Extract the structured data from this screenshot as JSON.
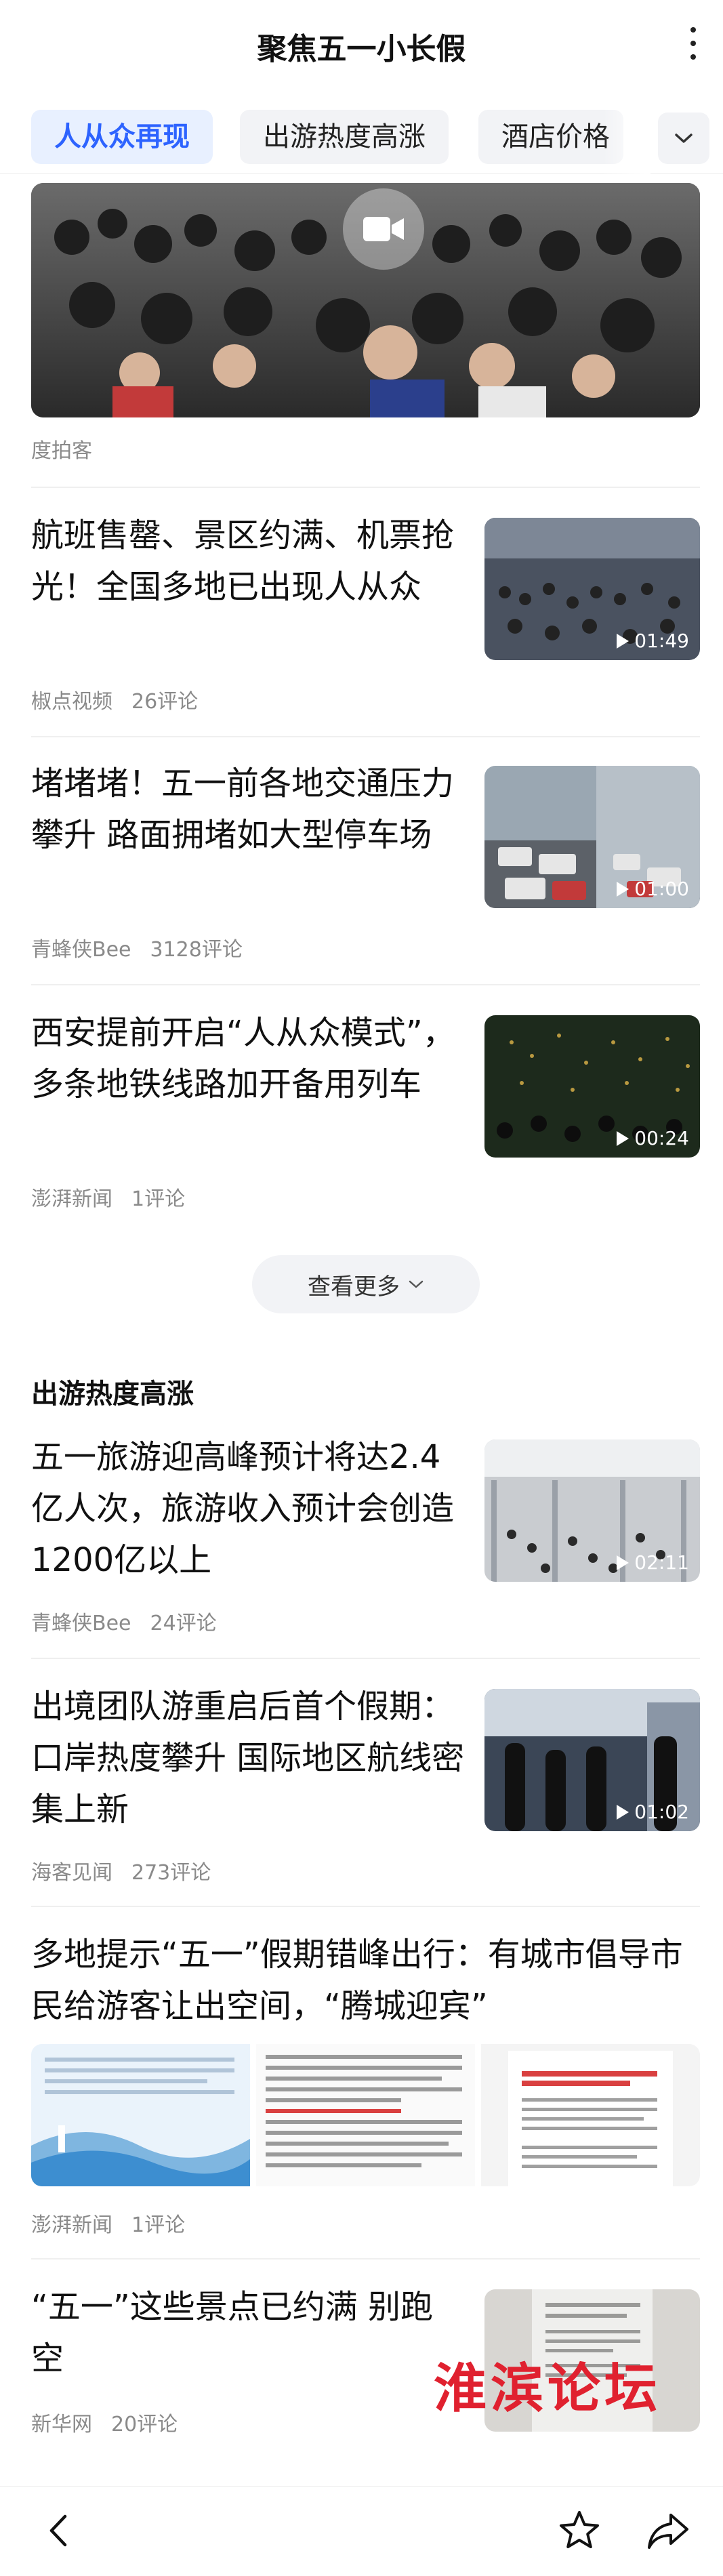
{
  "header": {
    "title": "聚焦五一小长假"
  },
  "tabs": [
    {
      "label": "人从众再现"
    },
    {
      "label": "出游热度高涨"
    },
    {
      "label": "酒店价格"
    }
  ],
  "hero": {
    "source": "度拍客"
  },
  "articles": [
    {
      "title": "航班售罄、景区约满、机票抢光！全国多地已出现人从众",
      "source": "椒点视频",
      "comments": "26评论",
      "duration": "01:49"
    },
    {
      "title": "堵堵堵！五一前各地交通压力攀升 路面拥堵如大型停车场",
      "source": "青蜂侠Bee",
      "comments": "3128评论",
      "duration": "01:00"
    },
    {
      "title": "西安提前开启“人从众模式”，多条地铁线路加开备用列车",
      "source": "澎湃新闻",
      "comments": "1评论",
      "duration": "00:24"
    }
  ],
  "see_more": {
    "label": "查看更多"
  },
  "section2": {
    "title": "出游热度高涨",
    "articles": [
      {
        "title": "五一旅游迎高峰预计将达2.4亿人次，旅游收入预计会创造1200亿以上",
        "source": "青蜂侠Bee",
        "comments": "24评论",
        "duration": "02:11"
      },
      {
        "title": "出境团队游重启后首个假期：口岸热度攀升 国际地区航线密集上新",
        "source": "海客见闻",
        "comments": "273评论",
        "duration": "01:02"
      }
    ],
    "wide_article": {
      "title": "多地提示“五一”假期错峰出行：有城市倡导市民给游客让出空间，“腾城迎宾”",
      "source": "澎湃新闻",
      "comments": "1评论"
    },
    "last_article": {
      "title": "“五一”这些景点已约满 别跑空",
      "source": "新华网",
      "comments": "20评论"
    }
  },
  "watermark": "淮滨论坛",
  "colors": {
    "accent": "#2d63ff",
    "watermark": "#e0212f",
    "meta": "#8a8a8a"
  }
}
